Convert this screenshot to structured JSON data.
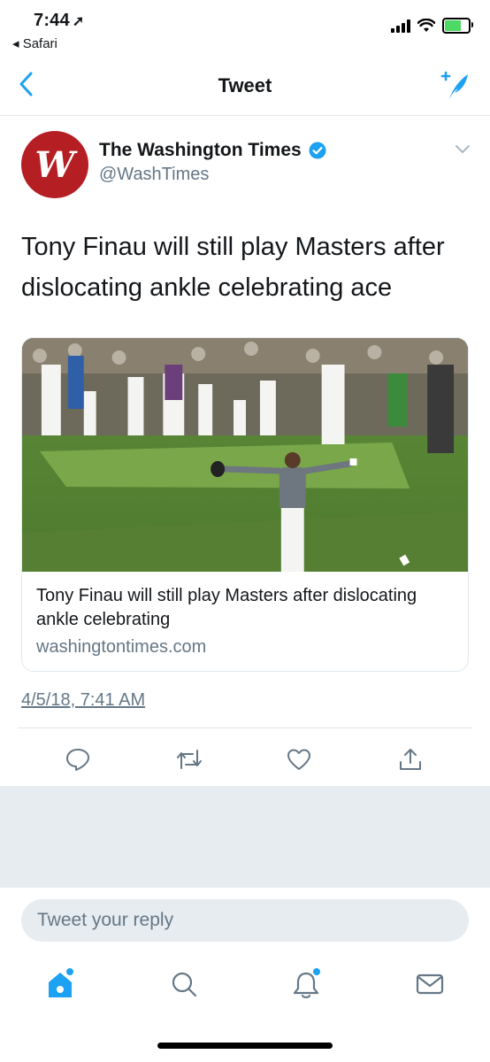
{
  "status_bar": {
    "time": "7:44",
    "back_app": "Safari"
  },
  "nav": {
    "title": "Tweet"
  },
  "tweet": {
    "author_name": "The Washington Times",
    "author_handle": "@WashTimes",
    "avatar_letter": "W",
    "text": "Tony Finau will still play Masters after dislocating ankle celebrating ace",
    "card": {
      "title": "Tony Finau will still play Masters after dislocating ankle celebrating",
      "domain": "washingtontimes.com"
    },
    "timestamp": "4/5/18, 7:41 AM"
  },
  "reply": {
    "placeholder": "Tweet your reply"
  },
  "colors": {
    "accent": "#1da1f2",
    "avatar_red": "#b51e23",
    "secondary_text": "#657786"
  }
}
